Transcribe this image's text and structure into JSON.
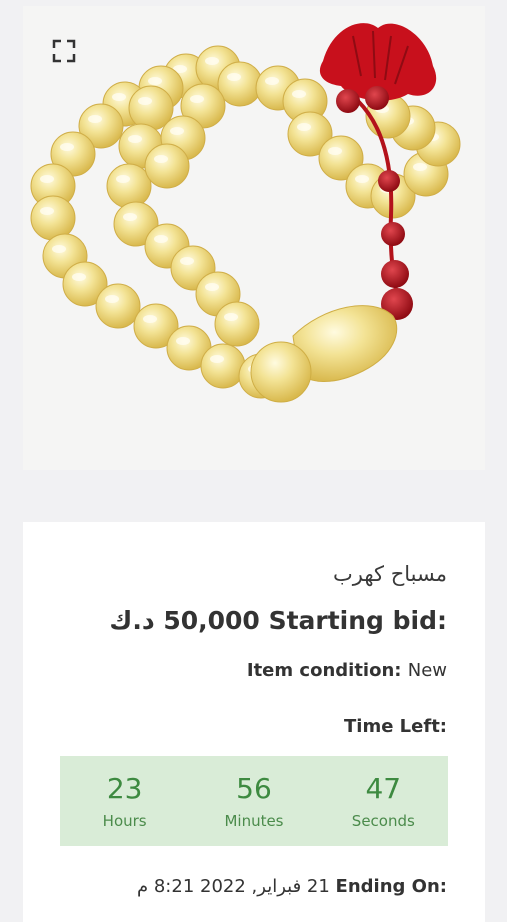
{
  "item": {
    "title": "مسباح كهرب",
    "starting_bid_label": "Starting bid:",
    "starting_bid_value": "50,000 د.ك",
    "condition_label": "Item condition:",
    "condition_value": "New",
    "time_left_label": "Time Left:",
    "ending_label": "Ending On:",
    "ending_value": "21 فبراير, 2022 8:21 م"
  },
  "countdown": {
    "hours": "23",
    "hours_label": "Hours",
    "minutes": "56",
    "minutes_label": "Minutes",
    "seconds": "47",
    "seconds_label": "Seconds"
  },
  "icons": {
    "expand": "expand-icon"
  },
  "colors": {
    "timer_bg": "#d9ecd7",
    "timer_text": "#3d8a40",
    "bead": "#f1df8a",
    "tassel": "#c8101c"
  }
}
